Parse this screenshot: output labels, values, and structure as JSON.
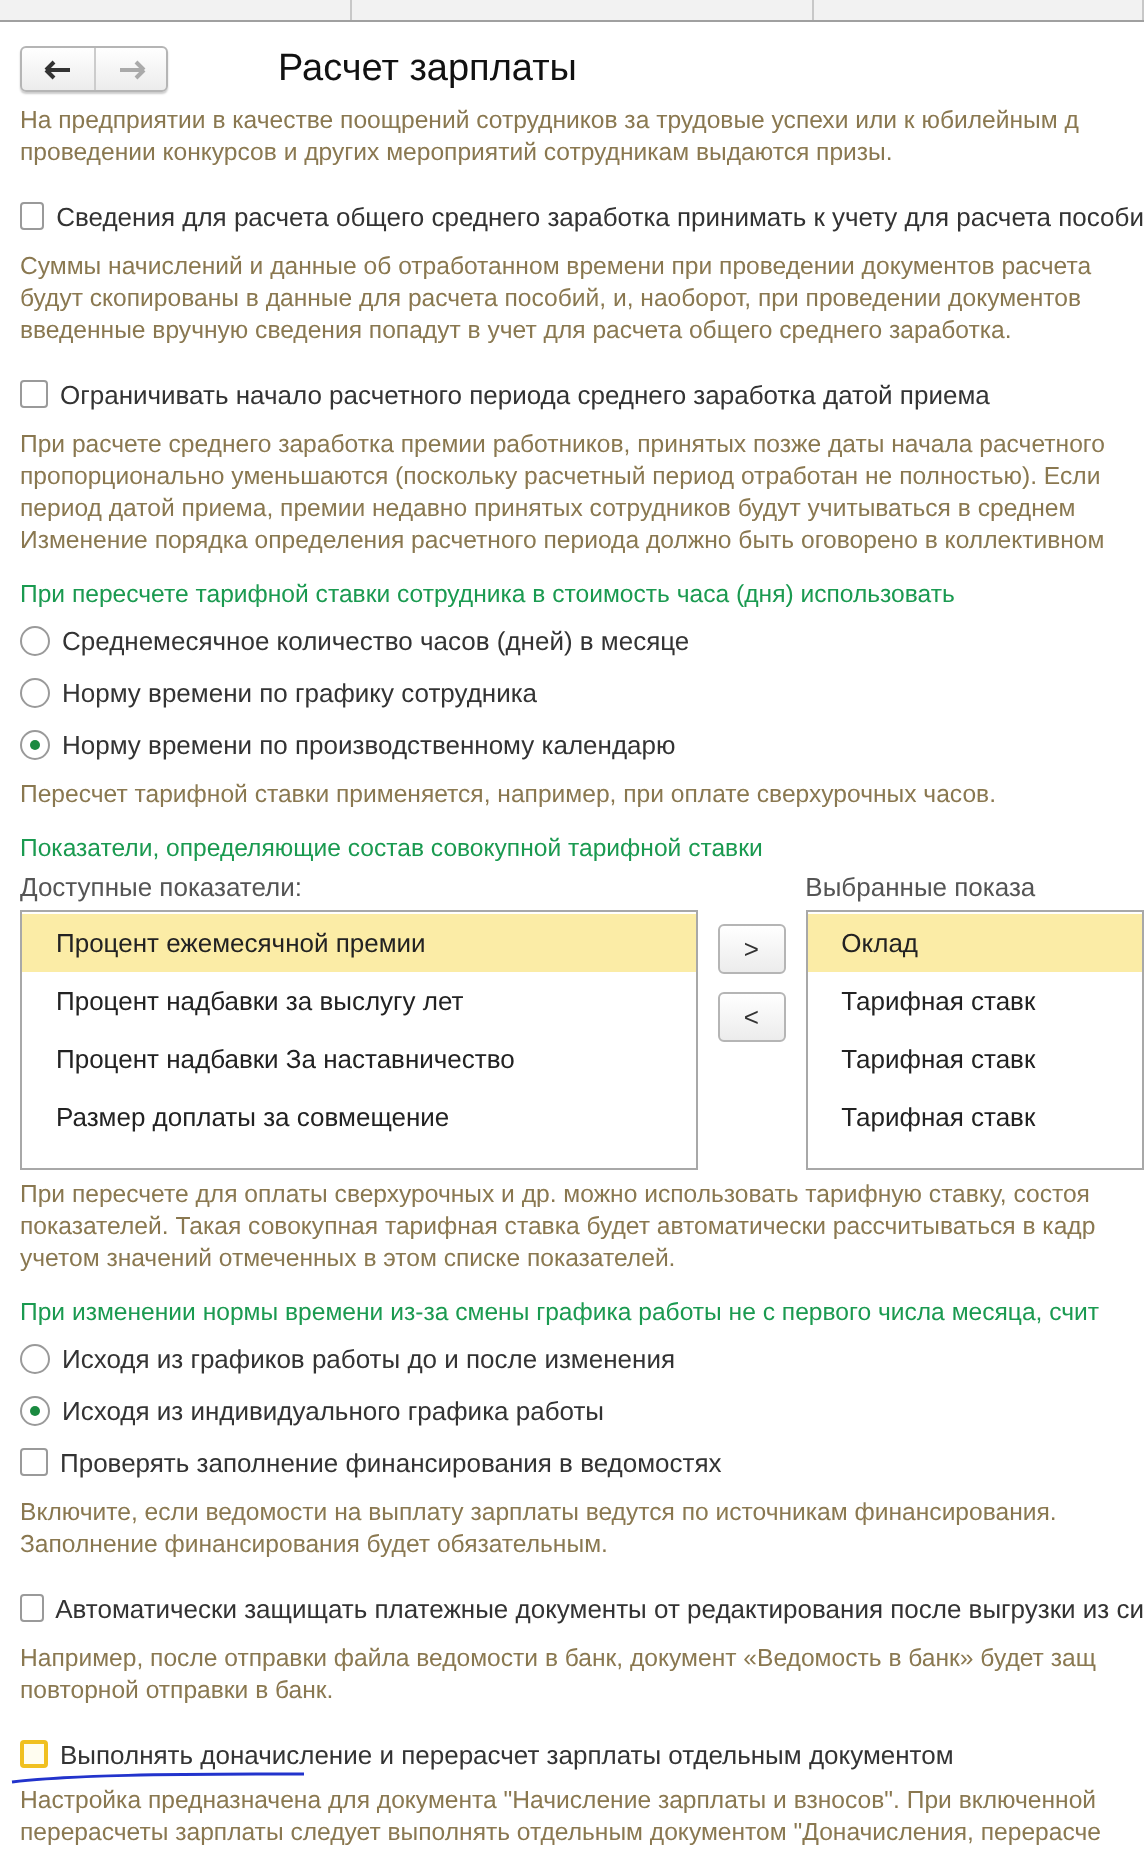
{
  "header": {
    "title": "Расчет зарплаты"
  },
  "sections": [
    {
      "kind": "paragraph",
      "lines": [
        "На предприятии в качестве поощрений сотрудников за трудовые успехи или к юбилейным д",
        "проведении конкурсов и других мероприятий сотрудникам выдаются призы."
      ]
    },
    {
      "kind": "checkbox",
      "label": "Сведения для расчета общего среднего заработка принимать к учету для расчета пособи",
      "checked": false
    },
    {
      "kind": "paragraph",
      "lines": [
        "Суммы начислений и данные об отработанном времени при проведении документов расчета",
        "будут скопированы в данные для расчета пособий, и, наоборот, при проведении документов",
        "введенные вручную сведения попадут в учет для расчета общего среднего заработка."
      ]
    },
    {
      "kind": "checkbox",
      "label": "Ограничивать начало расчетного периода среднего заработка датой приема",
      "checked": false
    },
    {
      "kind": "paragraph",
      "lines": [
        "При расчете среднего заработка премии работников, принятых позже даты начала расчетного",
        "пропорционально уменьшаются (поскольку расчетный период отработан не полностью). Если",
        "период датой приема, премии недавно принятых сотрудников будут учитываться в среднем",
        "Изменение порядка определения расчетного периода должно быть оговорено в коллективном"
      ]
    },
    {
      "kind": "heading",
      "text": "При пересчете тарифной ставки сотрудника в стоимость часа (дня) использовать"
    },
    {
      "kind": "radio",
      "label": "Среднемесячное количество часов (дней) в месяце",
      "selected": false
    },
    {
      "kind": "radio",
      "label": "Норму времени по графику сотрудника",
      "selected": false
    },
    {
      "kind": "radio",
      "label": "Норму времени по производственному календарю",
      "selected": true
    },
    {
      "kind": "paragraph",
      "lines": [
        "Пересчет тарифной ставки применяется, например, при оплате сверхурочных часов."
      ]
    },
    {
      "kind": "heading",
      "text": "Показатели, определяющие состав совокупной тарифной ставки"
    },
    {
      "kind": "lists",
      "available_label": "Доступные показатели:",
      "chosen_label": "Выбранные показа",
      "add_button": ">",
      "remove_button": "<",
      "available": [
        {
          "text": "Процент ежемесячной премии",
          "selected": true
        },
        {
          "text": "Процент надбавки за выслугу лет",
          "selected": false
        },
        {
          "text": "Процент надбавки За наставничество",
          "selected": false
        },
        {
          "text": "Размер доплаты за совмещение",
          "selected": false
        }
      ],
      "chosen": [
        {
          "text": "Оклад",
          "selected": true
        },
        {
          "text": "Тарифная ставк",
          "selected": false
        },
        {
          "text": "Тарифная ставк",
          "selected": false
        },
        {
          "text": "Тарифная ставк",
          "selected": false
        }
      ]
    },
    {
      "kind": "paragraph",
      "lines": [
        "При пересчете для оплаты сверхурочных и др. можно использовать тарифную ставку, состоя",
        "показателей. Такая совокупная тарифная ставка будет автоматически рассчитываться в кадр",
        "учетом значений отмеченных в этом списке показателей."
      ]
    },
    {
      "kind": "heading",
      "text": "При изменении нормы времени из-за смены графика работы не с первого числа месяца, счит"
    },
    {
      "kind": "radio",
      "label": "Исходя из графиков работы до и после изменения",
      "selected": false
    },
    {
      "kind": "radio",
      "label": "Исходя из индивидуального графика работы",
      "selected": true
    },
    {
      "kind": "checkbox",
      "label": "Проверять заполнение финансирования в ведомостях",
      "checked": false
    },
    {
      "kind": "paragraph",
      "lines": [
        "Включите, если ведомости на выплату зарплаты ведутся по источникам финансирования.",
        "Заполнение финансирования будет обязательным."
      ]
    },
    {
      "kind": "checkbox",
      "label": "Автоматически защищать платежные документы от редактирования после выгрузки из си",
      "checked": false
    },
    {
      "kind": "paragraph",
      "lines": [
        "Например, после отправки файла ведомости в банк, документ «Ведомость в банк» будет защ",
        "повторной отправки в банк."
      ]
    },
    {
      "kind": "checkbox",
      "label": "Выполнять доначисление и перерасчет зарплаты отдельным документом",
      "checked": false,
      "focused": true
    },
    {
      "kind": "pen_mark"
    },
    {
      "kind": "paragraph",
      "lines": [
        "Настройка предназначена для документа \"Начисление зарплаты и взносов\". При включенной",
        "перерасчеты зарплаты следует выполнять отдельным документом \"Доначисления, перерасче"
      ]
    }
  ]
}
